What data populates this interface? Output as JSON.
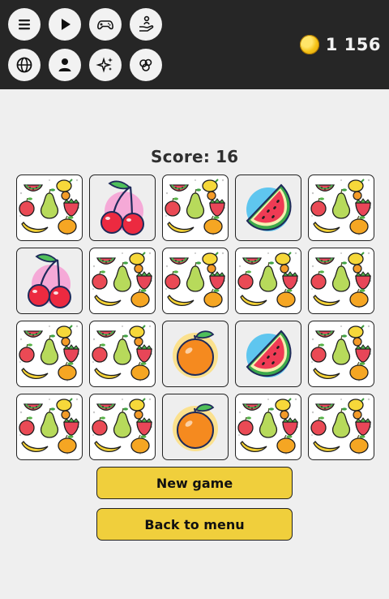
{
  "topbar": {
    "buttons": [
      {
        "name": "menu-button",
        "icon": "menu-icon"
      },
      {
        "name": "play-button",
        "icon": "play-icon"
      },
      {
        "name": "games-button",
        "icon": "gamepad-icon"
      },
      {
        "name": "support-button",
        "icon": "hand-person-icon"
      },
      {
        "name": "language-button",
        "icon": "globe-icon"
      },
      {
        "name": "profile-button",
        "icon": "user-icon"
      },
      {
        "name": "effects-button",
        "icon": "sparkles-icon"
      },
      {
        "name": "themes-button",
        "icon": "cloud-circles-icon"
      }
    ],
    "coins": "1 156"
  },
  "score": {
    "label": "Score:",
    "value": "16"
  },
  "board": {
    "columns": 5,
    "rows": 4,
    "cards": [
      "back",
      "cherry",
      "back",
      "watermelon",
      "back",
      "cherry",
      "back",
      "back",
      "back",
      "back",
      "back",
      "back",
      "orange",
      "watermelon",
      "back",
      "back",
      "back",
      "orange",
      "back",
      "back"
    ]
  },
  "buttons": {
    "new_game": "New game",
    "back_to_menu": "Back to menu"
  }
}
